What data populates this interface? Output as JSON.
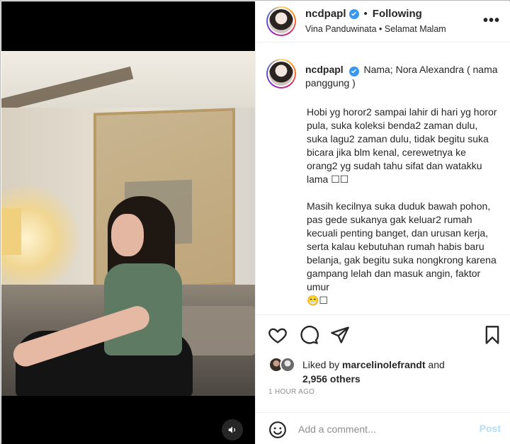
{
  "post": {
    "author": "ncdpapl",
    "follow_status": "Following",
    "separator": "•",
    "subtitle": "Vina Panduwinata • Selamat Malam",
    "more_label": "•••"
  },
  "caption": {
    "username": "ncdpapl",
    "intro": "Nama; Nora Alexandra ( nama panggung )",
    "body": "Hobi yg horor2 sampai lahir di hari yg horor pula, suka koleksi benda2 zaman dulu, suka lagu2 zaman dulu, tidak begitu suka bicara jika blm kenal, cerewetnya ke orang2 yg sudah tahu sifat dan watakku lama ☐☐\n\nMasih kecilnya suka duduk bawah pohon, pas gede sukanya gak keluar2 rumah kecuali penting banget, dan urusan kerja, serta kalau kebutuhan rumah habis baru belanja, gak begitu suka nongkrong karena gampang lelah dan masuk angin, faktor umur\n😁☐"
  },
  "likes": {
    "prefix": "Liked by ",
    "user": "marcelinolefrandt",
    "suffix": " and",
    "others": "2,956 others"
  },
  "timestamp": "1 HOUR AGO",
  "comment": {
    "placeholder": "Add a comment...",
    "post_label": "Post"
  },
  "icons": {
    "like": "heart-icon",
    "comment": "comment-icon",
    "share": "paper-plane-icon",
    "save": "bookmark-icon",
    "emoji": "smiley-icon",
    "volume": "speaker-icon",
    "verified": "verified-badge-icon",
    "more": "more-options-icon"
  },
  "colors": {
    "verified": "#3897f0",
    "post_button": "#b2dffc",
    "muted_text": "#8e8e8e",
    "text": "#262626"
  }
}
